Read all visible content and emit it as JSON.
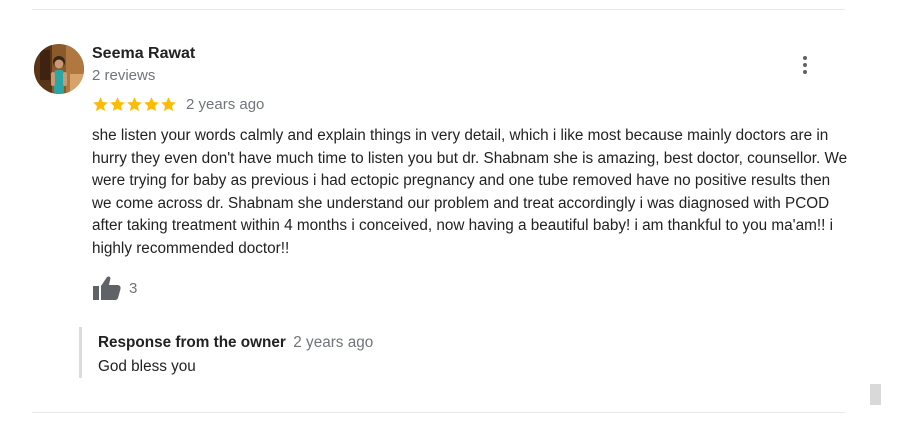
{
  "review": {
    "reviewer_name": "Seema Rawat",
    "reviewer_reviews": "2 reviews",
    "rating": 5,
    "rating_max": 5,
    "time": "2 years ago",
    "text": "she listen your words calmly and explain things in very detail, which i like most because mainly doctors are in hurry they even don't have much time to listen you but dr. Shabnam she is amazing, best doctor, counsellor. We were trying for baby as previous i had ectopic pregnancy and one tube removed have no positive results then we come across dr. Shabnam she understand our problem and  treat accordingly i was diagnosed with PCOD after taking treatment within 4 months i conceived, now having a beautiful baby! i am thankful to you ma'am!! i highly recommended doctor!!",
    "likes": "3",
    "more_icon": "more-vert-icon",
    "like_icon": "thumb-up-icon",
    "star_color": "#fbbc04"
  },
  "owner_response": {
    "title": "Response from the owner",
    "time": "2 years ago",
    "text": "God bless you"
  }
}
